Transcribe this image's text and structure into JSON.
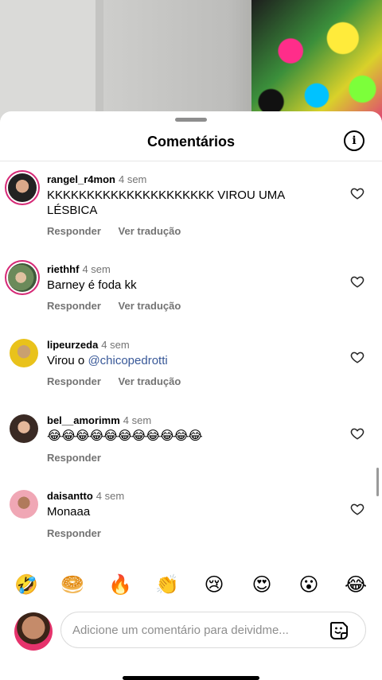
{
  "sheet": {
    "title": "Comentários",
    "info_icon": "info-icon"
  },
  "comments": [
    {
      "username": "rangel_r4mon",
      "time": "4 sem",
      "text": "KKKKKKKKKKKKKKKKKKKKK VIROU UMA LÉSBICA",
      "reply": "Responder",
      "translate": "Ver tradução",
      "avatar_color": "#2b2b2b",
      "story_ring": true
    },
    {
      "username": "riethhf",
      "time": "4 sem",
      "text": "Barney é foda kk",
      "reply": "Responder",
      "translate": "Ver tradução",
      "avatar_color": "#6b8a5a",
      "story_ring": true
    },
    {
      "username": "lipeurzeda",
      "time": "4 sem",
      "text_prefix": "Virou o ",
      "mention": "@chicopedrotti",
      "reply": "Responder",
      "translate": "Ver tradução",
      "avatar_color": "#e9c21b",
      "story_ring": false
    },
    {
      "username": "bel__amorimm",
      "time": "4 sem",
      "text": "😂😂😂😂😂😂😂😂😂😂😂",
      "reply": "Responder",
      "avatar_color": "#3a2a24",
      "story_ring": false
    },
    {
      "username": "daisantto",
      "time": "4 sem",
      "text": "Monaaa",
      "reply": "Responder",
      "avatar_color": "#f0a7b5",
      "story_ring": false
    }
  ],
  "emoji_bar": [
    "🤣",
    "🥯",
    "🔥",
    "👏",
    "😢",
    "😍",
    "😮",
    "😂"
  ],
  "composer": {
    "placeholder": "Adicione um comentário para deividme...",
    "sticker_icon": "sticker-icon"
  },
  "colors": {
    "mention": "#385898",
    "muted": "#737373",
    "ring": "#d62976"
  }
}
